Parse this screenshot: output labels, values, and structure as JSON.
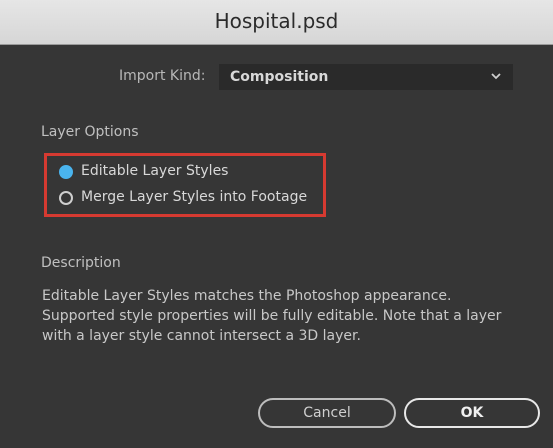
{
  "window": {
    "title": "Hospital.psd"
  },
  "import": {
    "label": "Import Kind:",
    "value": "Composition",
    "chevron_icon": "chevron-down-icon"
  },
  "layer_options": {
    "heading": "Layer Options",
    "options": [
      {
        "label": "Editable Layer Styles",
        "checked": true
      },
      {
        "label": "Merge Layer Styles into Footage",
        "checked": false
      }
    ],
    "highlight_color": "#d63a31",
    "radio_selected_color": "#4ab4ee"
  },
  "description": {
    "heading": "Description",
    "text": "Editable Layer Styles matches the Photoshop appearance. Supported style properties will be fully editable. Note that a layer with a layer style cannot intersect a 3D layer."
  },
  "buttons": {
    "cancel": "Cancel",
    "ok": "OK"
  }
}
